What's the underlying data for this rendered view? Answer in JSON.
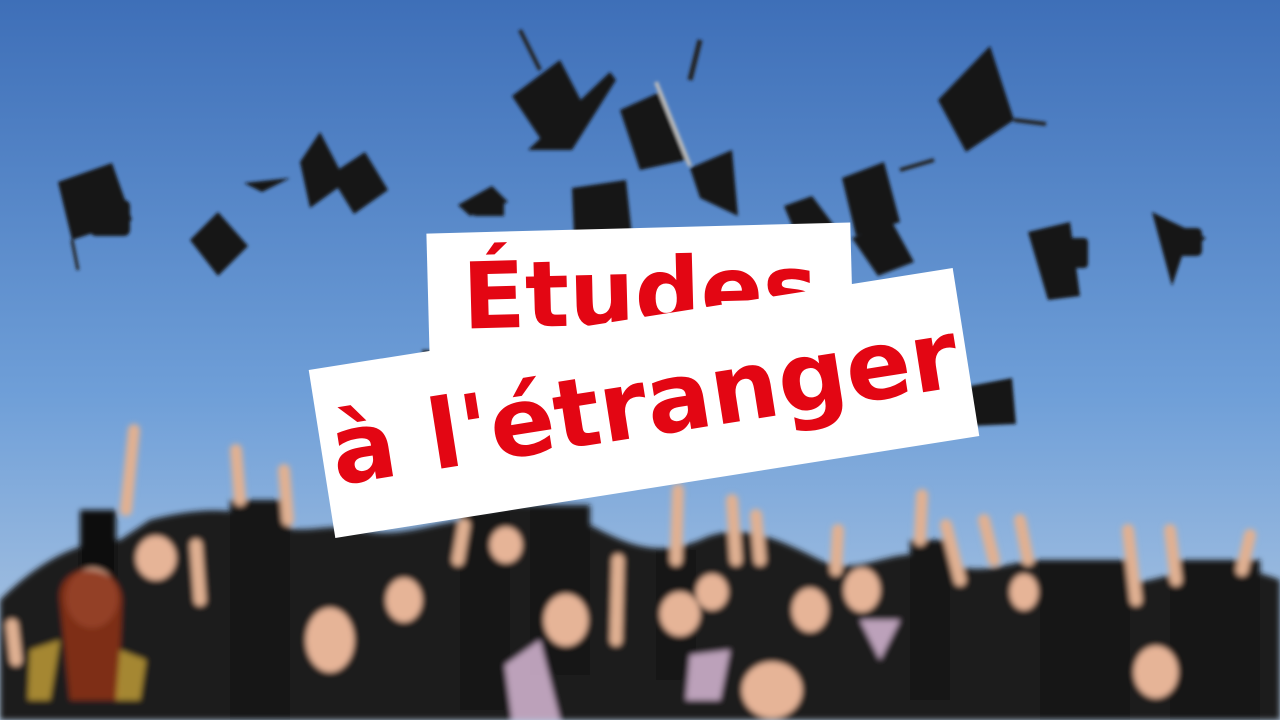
{
  "thumbnail": {
    "title_line_1": "Études",
    "title_line_2": "à l'étranger",
    "title_color": "#e30613",
    "title_background": "#ffffff"
  },
  "photo": {
    "sky_color": "#5f8fcf",
    "subject": "graduation-caps-thrown"
  }
}
